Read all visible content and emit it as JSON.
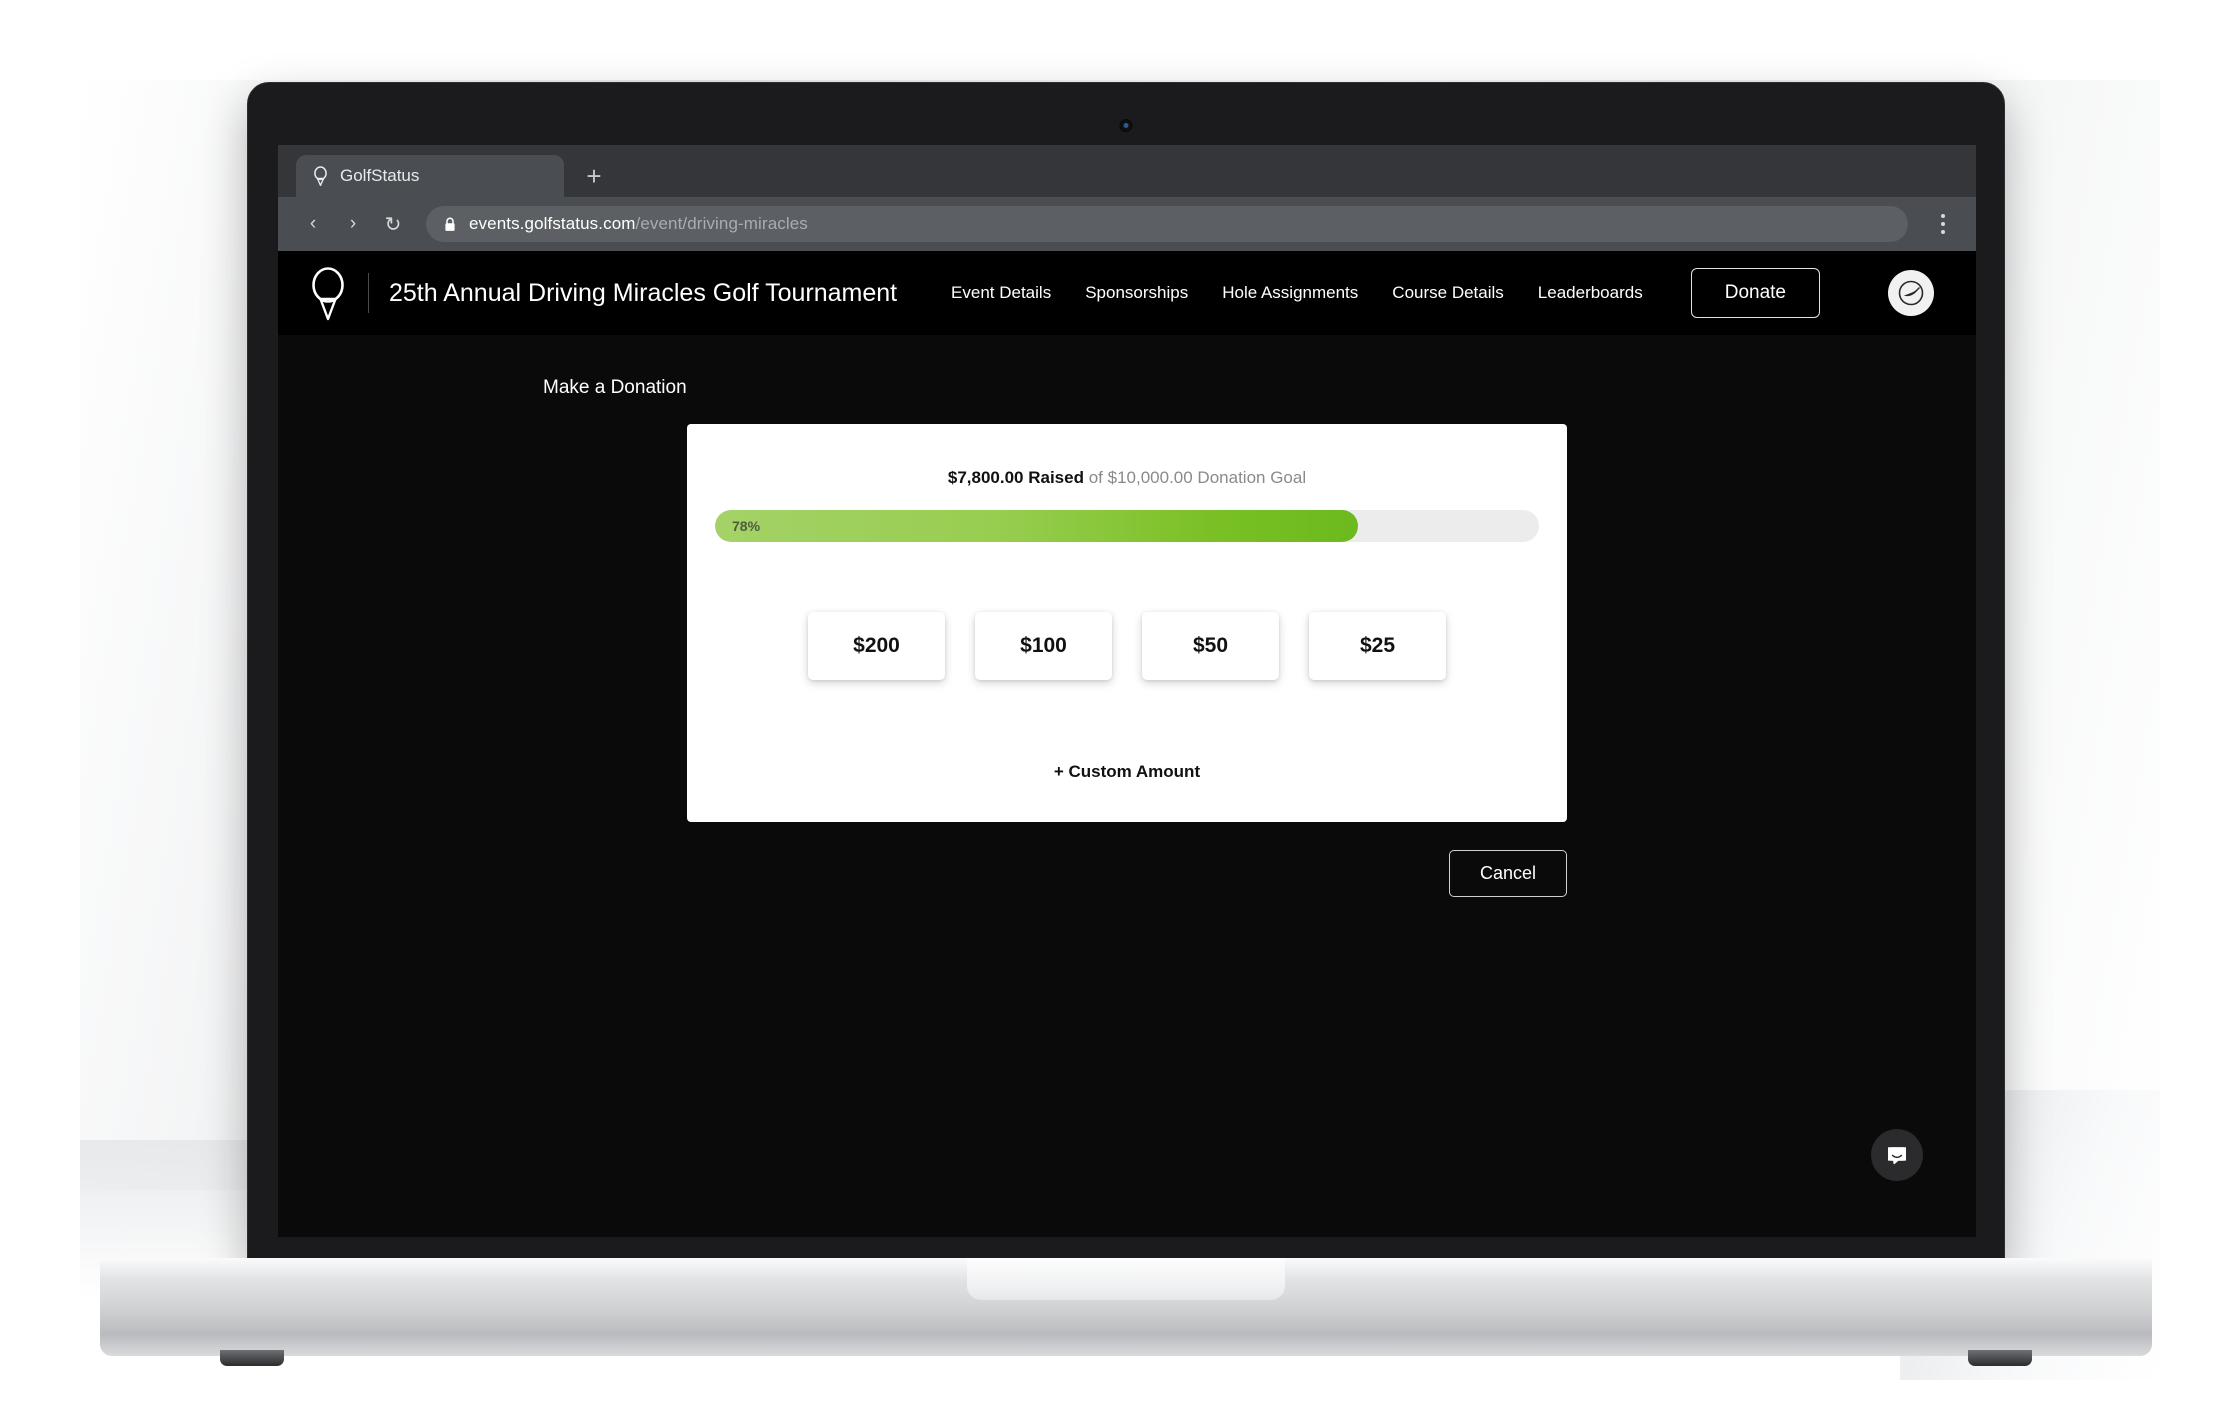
{
  "browser": {
    "tab": {
      "title": "GolfStatus",
      "favicon_icon": "golf-tee-icon"
    },
    "new_tab_label": "+",
    "back_icon": "‹",
    "forward_icon": "›",
    "reload_icon": "↻",
    "lock_icon": "lock-icon",
    "url_host": "events.golfstatus.com",
    "url_path": "/event/driving-miracles",
    "menu_icon": "kebab-menu-icon"
  },
  "site": {
    "logo_icon": "golf-tee-logo-icon",
    "title": "25th Annual Driving Miracles Golf Tournament",
    "nav": [
      {
        "label": "Event Details"
      },
      {
        "label": "Sponsorships"
      },
      {
        "label": "Hole Assignments"
      },
      {
        "label": "Course Details"
      },
      {
        "label": "Leaderboards"
      }
    ],
    "donate_label": "Donate",
    "avatar_icon": "user-avatar-icon"
  },
  "donation": {
    "section_label": "Make a Donation",
    "raised_amount": "$7,800.00 Raised",
    "goal_text": "of $10,000.00 Donation Goal",
    "progress_percent_label": "78%",
    "progress_percent": 78,
    "amounts": [
      {
        "label": "$200"
      },
      {
        "label": "$100"
      },
      {
        "label": "$50"
      },
      {
        "label": "$25"
      }
    ],
    "custom_amount_label": "+ Custom Amount",
    "cancel_label": "Cancel"
  },
  "chat": {
    "icon": "chat-bubble-icon"
  },
  "colors": {
    "progress_start": "#a4d267",
    "progress_end": "#6cba1e",
    "progress_track": "#ececec",
    "site_bg": "#0a0a0a",
    "header_bg": "#000000"
  }
}
